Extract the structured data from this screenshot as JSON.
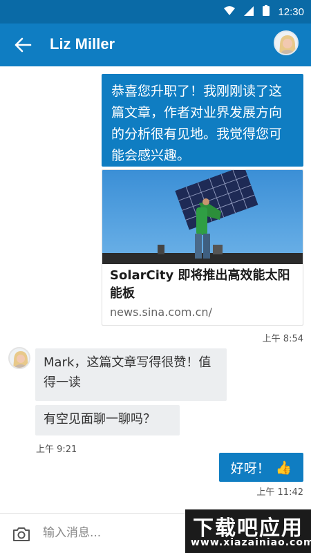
{
  "status_bar": {
    "time": "12:30"
  },
  "header": {
    "contact_name": "Liz Miller"
  },
  "messages": {
    "outgoing_text": "恭喜您升职了！我刚刚读了这篇文章，作者对业界发展方向的分析很有见地。我觉得您可能会感兴趣。",
    "link_title": "SolarCity 即将推出高效能太阳能板",
    "link_url": "news.sina.com.cn/",
    "outgoing_time": "上午 8:54",
    "incoming_1": "Mark，这篇文章写得很赞！值得一读",
    "incoming_2": "有空见面聊一聊吗？",
    "incoming_time": "上午 9:21",
    "reply_text": "好呀！",
    "reply_emoji": "👍",
    "reply_time": "上午 11:42"
  },
  "composer": {
    "placeholder": "输入消息..."
  },
  "watermark": {
    "title": "下载吧应用",
    "url": "www.xiazainiao.com"
  },
  "colors": {
    "header": "#0f7dc2",
    "status_bar": "#0a6aa6",
    "incoming_bubble": "#eceef0"
  },
  "icons": [
    "wifi-icon",
    "signal-icon",
    "battery-icon",
    "back-arrow-icon",
    "camera-icon",
    "thumbs-up-emoji"
  ]
}
